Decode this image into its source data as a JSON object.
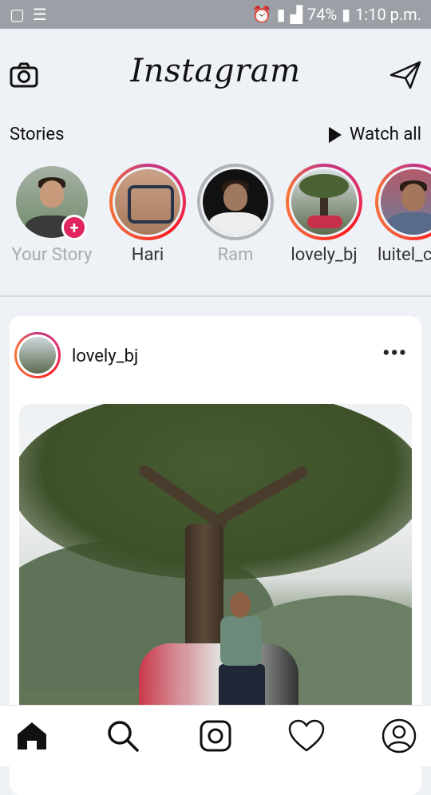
{
  "status_bar": {
    "battery": "74%",
    "time": "1:10 p.m."
  },
  "header": {
    "logo": "Instagram",
    "camera_icon": "camera-icon",
    "direct_icon": "paper-plane-icon"
  },
  "stories_section": {
    "title": "Stories",
    "watch_all": "Watch all",
    "items": [
      {
        "name": "Your Story",
        "state": "own"
      },
      {
        "name": "Hari",
        "state": "unseen"
      },
      {
        "name": "Ram",
        "state": "seen"
      },
      {
        "name": "lovely_bj",
        "state": "unseen"
      },
      {
        "name": "luitel_c",
        "state": "unseen"
      }
    ]
  },
  "post": {
    "username": "lovely_bj",
    "more_label": "•••"
  },
  "bottom_nav": {
    "items": [
      "home-icon",
      "search-icon",
      "reels-icon",
      "heart-icon",
      "profile-icon"
    ]
  },
  "colors": {
    "story_gradient": "#e1306c",
    "add_story_badge": "#e0245e",
    "status_bar_bg": "#9aa0a6"
  }
}
